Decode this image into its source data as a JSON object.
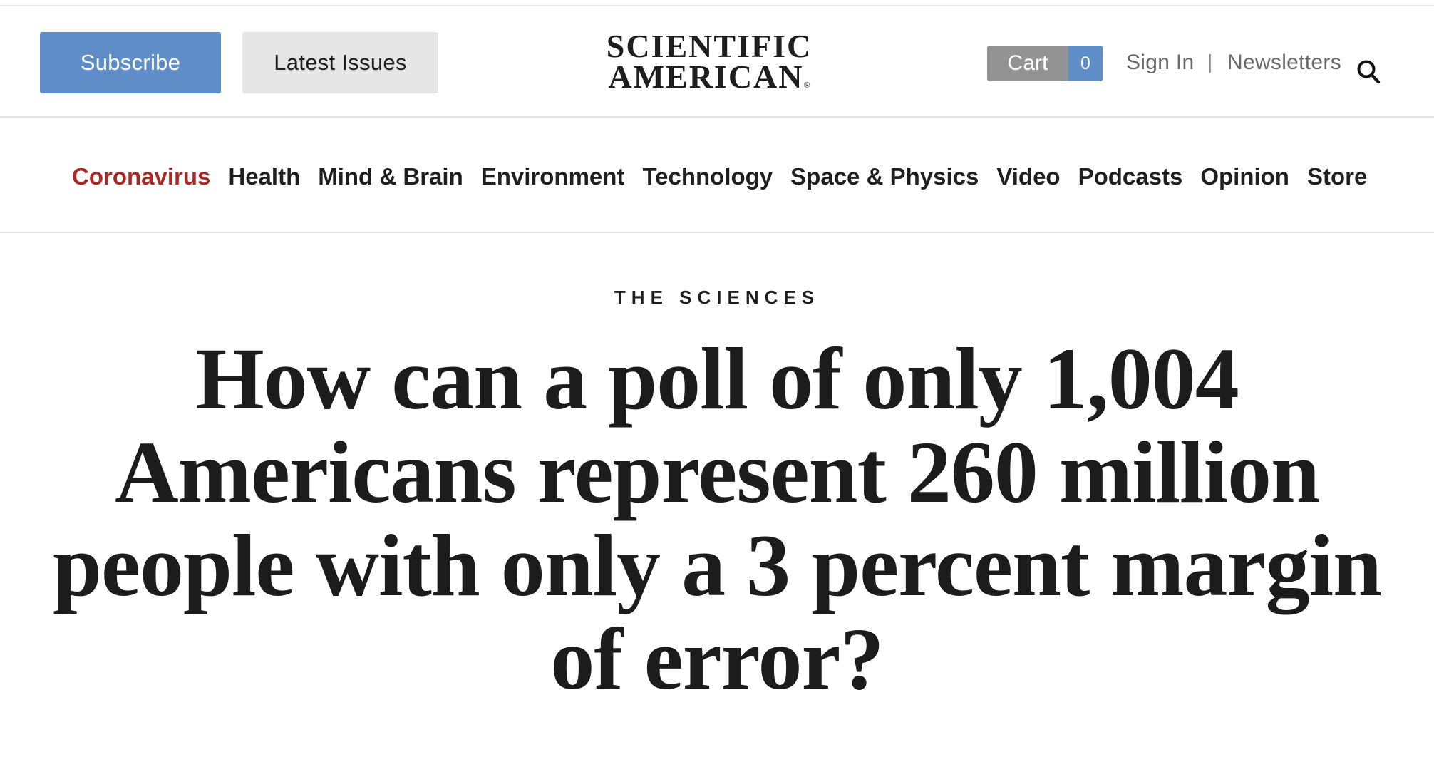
{
  "header": {
    "subscribe_label": "Subscribe",
    "latest_issues_label": "Latest Issues",
    "logo": {
      "line1": "SCIENTIFIC",
      "line2": "AMERICAN",
      "registered": "®"
    },
    "cart": {
      "label": "Cart",
      "count": "0"
    },
    "sign_in_label": "Sign In",
    "divider": "|",
    "newsletters_label": "Newsletters",
    "search_icon": "search-icon"
  },
  "nav": {
    "items": [
      {
        "label": "Coronavirus"
      },
      {
        "label": "Health"
      },
      {
        "label": "Mind & Brain"
      },
      {
        "label": "Environment"
      },
      {
        "label": "Technology"
      },
      {
        "label": "Space & Physics"
      },
      {
        "label": "Video"
      },
      {
        "label": "Podcasts"
      },
      {
        "label": "Opinion"
      },
      {
        "label": "Store"
      }
    ]
  },
  "article": {
    "kicker": "THE SCIENCES",
    "title": "How can a poll of only 1,004 Americans represent 260 million people with only a 3 percent margin of error?"
  },
  "colors": {
    "subscribe_bg": "#5f8dc7",
    "latest_issues_bg": "#e6e6e6",
    "cart_bg": "#939393",
    "cart_count_bg": "#5f8dc7",
    "nav_highlight": "#a72a27",
    "text": "#1b1b1b"
  }
}
